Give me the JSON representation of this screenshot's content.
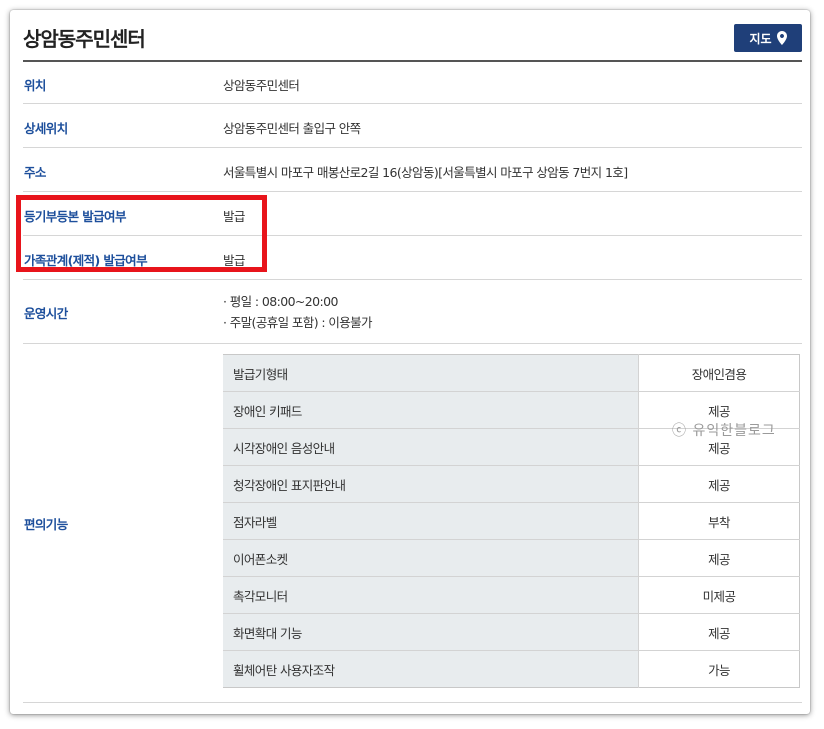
{
  "header": {
    "title": "상암동주민센터",
    "map_button_label": "지도",
    "map_icon": "location-pin-icon"
  },
  "rows": {
    "location": {
      "label": "위치",
      "value": "상암동주민센터"
    },
    "detail_location": {
      "label": "상세위치",
      "value": "상암동주민센터 출입구 안쪽"
    },
    "address": {
      "label": "주소",
      "value": "서울특별시 마포구 매봉산로2길 16(상암동)[서울특별시 마포구 상암동 7번지 1호]"
    },
    "registry_issue": {
      "label": "등기부등본 발급여부",
      "value": "발급"
    },
    "family_issue": {
      "label": "가족관계(제적) 발급여부",
      "value": "발급"
    },
    "hours": {
      "label": "운영시간",
      "lines": [
        "· 평일 : 08:00~20:00",
        "· 주말(공휴일 포함) : 이용불가"
      ]
    },
    "facilities": {
      "label": "편의기능",
      "items": [
        {
          "name": "발급기형태",
          "value": "장애인겸용"
        },
        {
          "name": "장애인 키패드",
          "value": "제공"
        },
        {
          "name": "시각장애인 음성안내",
          "value": "제공"
        },
        {
          "name": "청각장애인 표지판안내",
          "value": "제공"
        },
        {
          "name": "점자라벨",
          "value": "부착"
        },
        {
          "name": "이어폰소켓",
          "value": "제공"
        },
        {
          "name": "촉각모니터",
          "value": "미제공"
        },
        {
          "name": "화면확대 기능",
          "value": "제공"
        },
        {
          "name": "휠체어탄 사용자조작",
          "value": "가능"
        }
      ]
    }
  },
  "watermark": "ⓒ 유익한블로그",
  "colors": {
    "label_blue": "#1d4f9c",
    "button_navy": "#1f3f79",
    "highlight_red": "#e8141b",
    "table_name_bg": "#e8ecee"
  }
}
